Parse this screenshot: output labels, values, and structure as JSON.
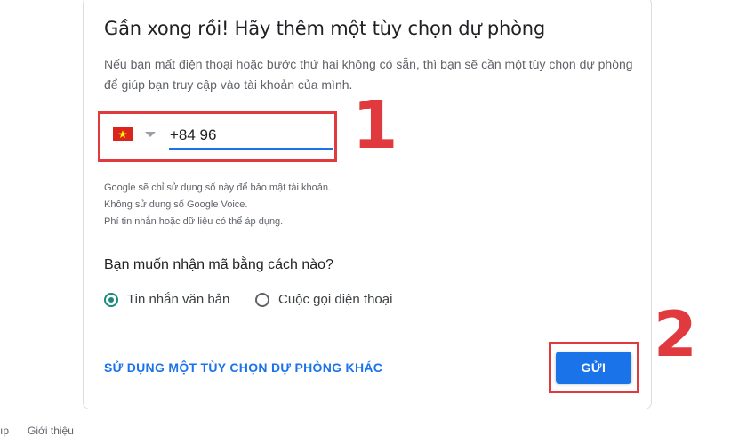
{
  "heading": "Gần xong rồi! Hãy thêm một tùy chọn dự phòng",
  "description": "Nếu bạn mất điện thoại hoặc bước thứ hai không có sẵn, thì bạn sẽ cần một tùy chọn dự phòng để giúp bạn truy cập vào tài khoản của mình.",
  "phone": {
    "country_flag_icon": "vietnam-flag-icon",
    "value": "+84 96"
  },
  "callouts": {
    "one": "1",
    "two": "2"
  },
  "notes": [
    "Google sẽ chỉ sử dụng số này để bảo mật tài khoản.",
    "Không sử dụng số Google Voice.",
    "Phí tin nhắn hoặc dữ liệu có thể áp dụng."
  ],
  "question": "Bạn muốn nhận mã bằng cách nào?",
  "options": {
    "sms": "Tin nhắn văn bản",
    "call": "Cuộc gọi điện thoại",
    "selected": "sms"
  },
  "alt_link": "SỬ DỤNG MỘT TÙY CHỌN DỰ PHÒNG KHÁC",
  "send_button": "GỬI",
  "footer": {
    "left_fragment": "ıp",
    "about": "Giới thiệu"
  },
  "colors": {
    "accent": "#1a73e8",
    "annotation": "#e03a3e",
    "radio_selected": "#1a8a7a",
    "flag_red": "#da251d",
    "flag_star": "#ffff00"
  }
}
